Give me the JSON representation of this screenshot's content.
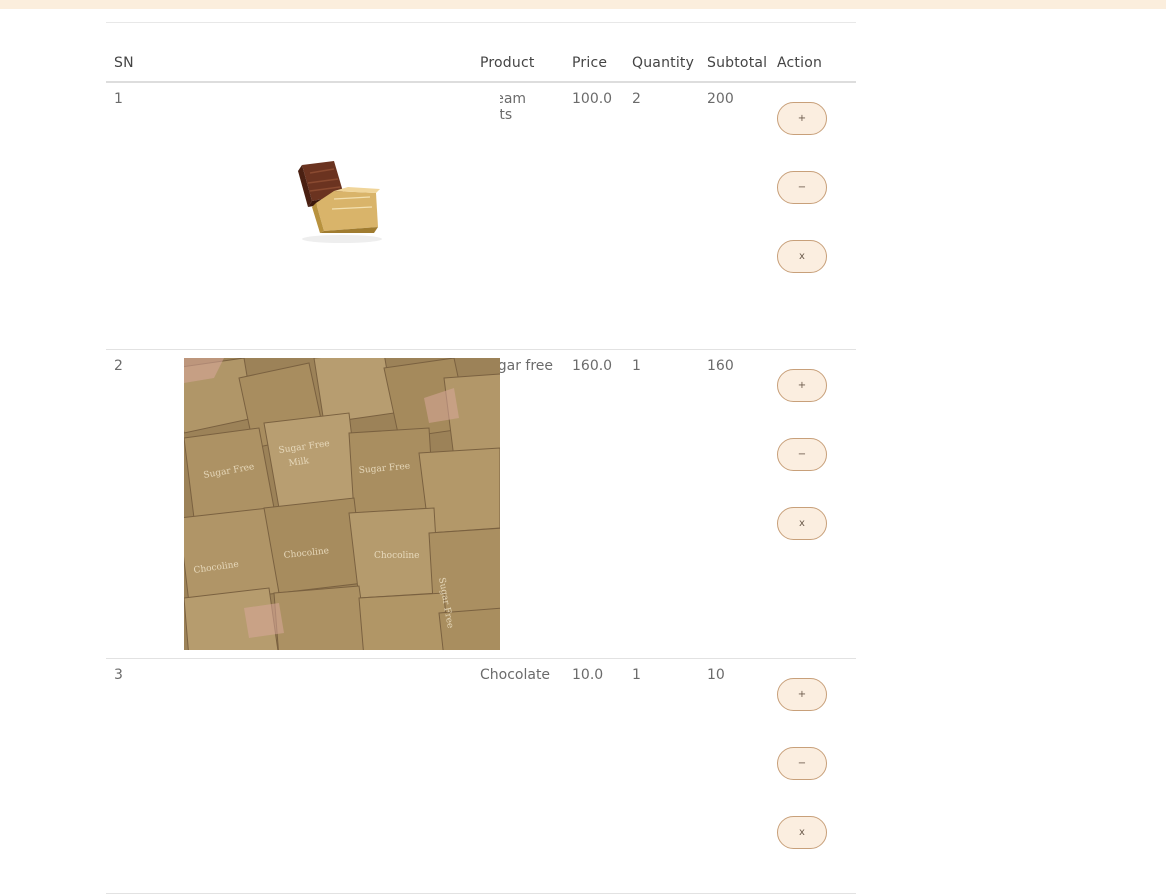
{
  "table": {
    "headers": {
      "sn": "SN",
      "image": "",
      "product": "Product",
      "price": "Price",
      "quantity": "Quantity",
      "subtotal": "Subtotal",
      "action": "Action"
    },
    "rows": [
      {
        "sn": "1",
        "product": "Cream Nuts",
        "price": "100.0",
        "quantity": "2",
        "subtotal": "200",
        "actions": {
          "increase": "+",
          "decrease": "−",
          "remove": "x"
        }
      },
      {
        "sn": "2",
        "product": "Sugar free",
        "price": "160.0",
        "quantity": "1",
        "subtotal": "160",
        "actions": {
          "increase": "+",
          "decrease": "−",
          "remove": "x"
        }
      },
      {
        "sn": "3",
        "product": "Chocolate",
        "price": "10.0",
        "quantity": "1",
        "subtotal": "10",
        "actions": {
          "increase": "+",
          "decrease": "−",
          "remove": "x"
        }
      }
    ]
  },
  "colors": {
    "accent": "#fbeedd",
    "button_border": "#c8a07a",
    "button_bg": "#fbeee0"
  }
}
